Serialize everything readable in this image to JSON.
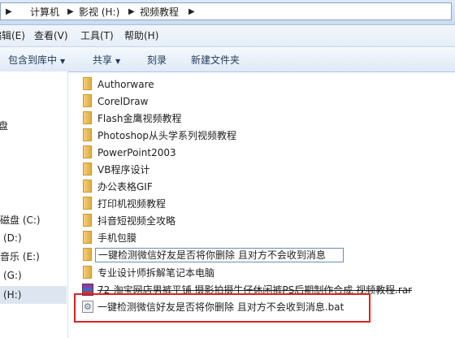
{
  "address_bar": {
    "crumbs": [
      "计算机",
      "影视 (H:)",
      "视频教程"
    ]
  },
  "menu": {
    "items": [
      "编辑(E)",
      "查看(V)",
      "工具(T)",
      "帮助(H)"
    ]
  },
  "toolbar": {
    "include_label": "包含到库中",
    "share_label": "共享",
    "burn_label": "刻录",
    "new_folder_label": "新建文件夹"
  },
  "nav_pane": {
    "items": [
      "盘",
      "磁盘 (C:)",
      "(D:)",
      "音乐 (E:)",
      "(G:)",
      "(H:)"
    ]
  },
  "files": [
    {
      "name": "Authorware",
      "type": "folder"
    },
    {
      "name": "CorelDraw",
      "type": "folder"
    },
    {
      "name": "Flash金鹰视频教程",
      "type": "folder"
    },
    {
      "name": "Photoshop从头学系列视频教程",
      "type": "folder"
    },
    {
      "name": "PowerPoint2003",
      "type": "folder"
    },
    {
      "name": "VB程序设计",
      "type": "folder"
    },
    {
      "name": "办公表格GIF",
      "type": "folder"
    },
    {
      "name": "打印机视频教程",
      "type": "folder"
    },
    {
      "name": "抖音短视频全攻略",
      "type": "folder"
    },
    {
      "name": "手机包膜",
      "type": "folder"
    },
    {
      "name": "一键检测微信好友是否将你删除 且对方不会收到消息",
      "type": "folder-rename"
    },
    {
      "name": "专业设计师拆解笔记本电脑",
      "type": "folder"
    },
    {
      "name": "72-淘宝网店男裤平铺 摄影拍摄牛仔休闲裤PS后期制作合成 视频教程.rar",
      "type": "rar"
    },
    {
      "name": "一键检测微信好友是否将你删除 且对方不会收到消息.bat",
      "type": "bat"
    }
  ],
  "colors": {
    "highlight": "#e02020",
    "selection": "#dde6f0",
    "toolbar_text": "#1e395b"
  }
}
